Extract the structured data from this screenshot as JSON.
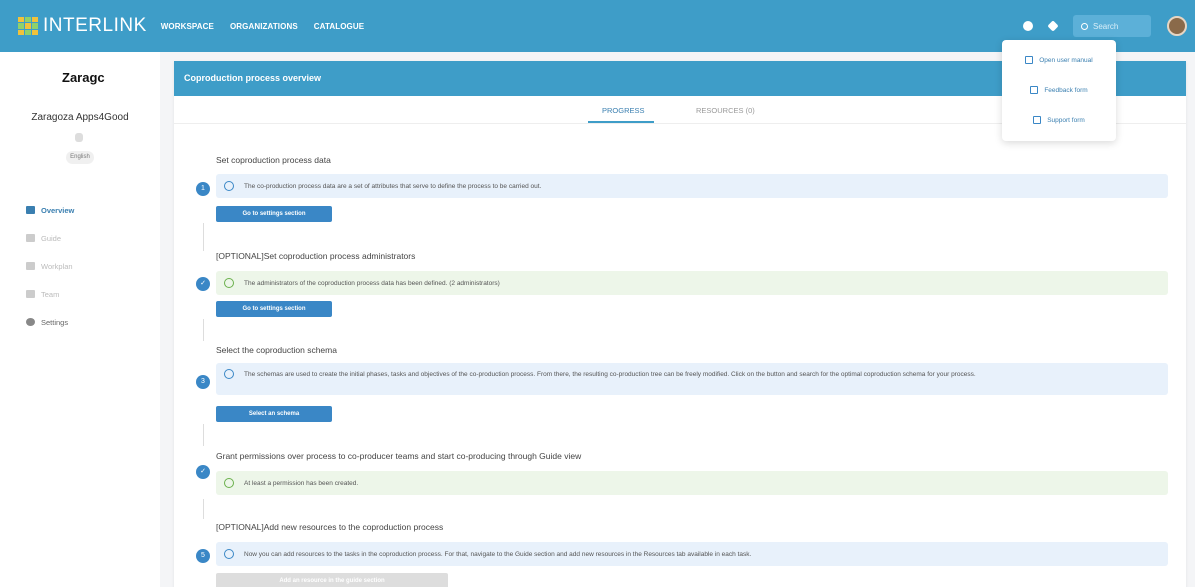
{
  "app": {
    "logo_text": "INTERLINK",
    "nav": [
      "WORKSPACE",
      "ORGANIZATIONS",
      "CATALOGUE"
    ],
    "search_placeholder": "Search"
  },
  "sidebar": {
    "org_logo": "Zaragc",
    "org_name": "Zaragoza Apps4Good",
    "language": "English",
    "items": [
      {
        "label": "Overview",
        "icon": "grid-icon"
      },
      {
        "label": "Guide",
        "icon": "tree-icon"
      },
      {
        "label": "Workplan",
        "icon": "chart-icon"
      },
      {
        "label": "Team",
        "icon": "people-icon"
      },
      {
        "label": "Settings",
        "icon": "gear-icon"
      }
    ]
  },
  "main": {
    "header": "Coproduction process overview",
    "tabs": [
      "PROGRESS",
      "RESOURCES (0)"
    ],
    "steps": [
      {
        "title": "Set coproduction process data",
        "status": "pending",
        "number": "1",
        "alert": "The co-production process data are a set of attributes that serve to define the process to be carried out.",
        "button": "Go to settings section"
      },
      {
        "title": "[OPTIONAL]Set coproduction process administrators",
        "status": "done",
        "alert": "The administrators of the coproduction process data has been defined. (2 administrators)",
        "button": "Go to settings section"
      },
      {
        "title": "Select the coproduction schema",
        "status": "pending",
        "number": "3",
        "alert": "The schemas are used to create the initial phases, tasks and objectives of the co-production process. From there, the resulting co-production tree can be freely modified. Click on the button and search for the optimal coproduction schema for your process.",
        "button": "Select an schema"
      },
      {
        "title": "Grant permissions over process to co-producer teams and start co-producing through Guide view",
        "status": "done",
        "alert": "At least a permission has been created."
      },
      {
        "title": "[OPTIONAL]Add new resources to the coproduction process",
        "status": "pending",
        "number": "5",
        "alert": "Now you can add resources to the tasks in the coproduction process. For that, navigate to the Guide section and add new resources in the Resources tab available in each task.",
        "button": "Add an resource in the guide section"
      }
    ]
  },
  "help_menu": {
    "items": [
      "Open user manual",
      "Feedback form",
      "Support form"
    ]
  }
}
